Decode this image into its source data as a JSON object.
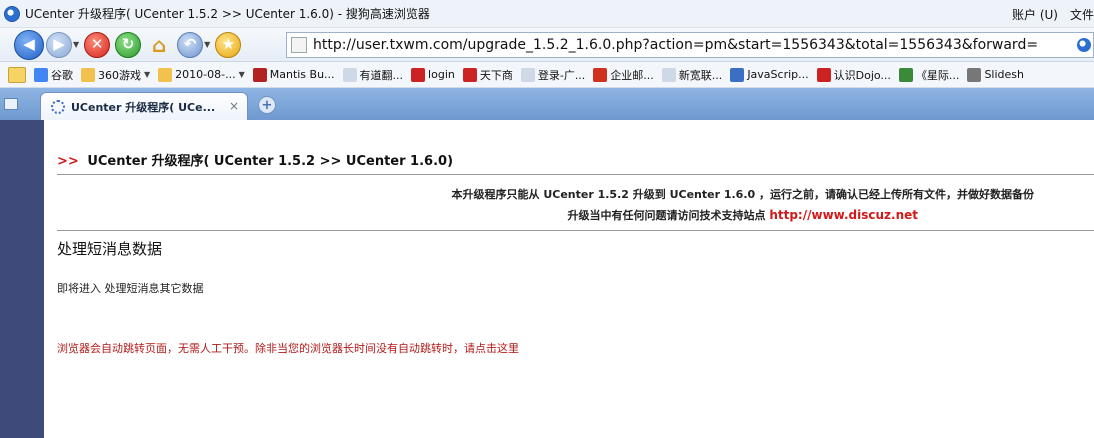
{
  "window": {
    "title": "UCenter 升级程序( UCenter 1.5.2 >> UCenter 1.6.0) - 搜狗高速浏览器",
    "menu": [
      "账户 (U)",
      "文件"
    ]
  },
  "address_bar": {
    "url": "http://user.txwm.com/upgrade_1.5.2_1.6.0.php?action=pm&start=1556343&total=1556343&forward="
  },
  "bookmarks": [
    {
      "label": "谷歌",
      "icon": "google-icon",
      "color": "#4285f4"
    },
    {
      "label": "360游戏",
      "icon": "folder-icon",
      "color": "#f2c14e",
      "caret": true
    },
    {
      "label": "2010-08-...",
      "icon": "folder-icon",
      "color": "#f2c14e",
      "caret": true
    },
    {
      "label": "Mantis Bu...",
      "icon": "mantis-icon",
      "color": "#b22222"
    },
    {
      "label": "有道翻...",
      "icon": "page-icon",
      "color": "#cfd8e6"
    },
    {
      "label": "login",
      "icon": "login-icon",
      "color": "#cc2222"
    },
    {
      "label": "天下商",
      "icon": "tianxiashang-icon",
      "color": "#cc2222"
    },
    {
      "label": "登录-广...",
      "icon": "page-icon",
      "color": "#cfd8e6"
    },
    {
      "label": "企业邮...",
      "icon": "mail-icon",
      "color": "#d03020"
    },
    {
      "label": "新宽联...",
      "icon": "page-icon",
      "color": "#cfd8e6"
    },
    {
      "label": "JavaScrip...",
      "icon": "js-icon",
      "color": "#3a6fc4"
    },
    {
      "label": "认识Dojo...",
      "icon": "dojo-icon",
      "color": "#cc2222"
    },
    {
      "label": "《星际...",
      "icon": "starcraft-icon",
      "color": "#3a8a3a"
    },
    {
      "label": "Slidesh",
      "icon": "slideshare-icon",
      "color": "#777777"
    }
  ],
  "tab": {
    "label": "UCenter 升级程序( UCe...",
    "close": "×",
    "new_tab": "+"
  },
  "page": {
    "header_arrows": ">>",
    "header_title": "UCenter 升级程序( UCenter 1.5.2 >> UCenter 1.6.0)",
    "notice_line1": "本升级程序只能从 UCenter 1.5.2 升级到 UCenter 1.6.0 ，运行之前，请确认已经上传所有文件，并做好数据备份",
    "notice_line2": "升级当中有任何问题请访问技术支持站点",
    "support_link": "http://www.discuz.net",
    "section_title": "处理短消息数据",
    "next_step": "即将进入 处理短消息其它数据",
    "redirect_text": "浏览器会自动跳转页面，无需人工干预。除非当您的浏览器长时间没有自动跳转时，请点击这里"
  },
  "colors": {
    "accent_red": "#d01a1a",
    "redirect_red": "#b21a1a",
    "side_frame": "#3d4a7a",
    "tabbar": "#7fa6da"
  }
}
